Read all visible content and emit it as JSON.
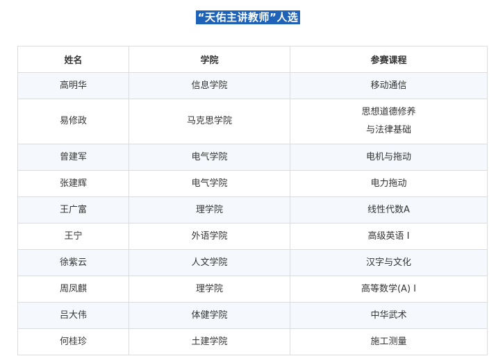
{
  "title": "“天佑主讲教师”人选",
  "headers": [
    "姓名",
    "学院",
    "参赛课程"
  ],
  "rows": [
    {
      "name": "高明华",
      "college": "信息学院",
      "course": [
        "移动通信"
      ]
    },
    {
      "name": "易修政",
      "college": "马克思学院",
      "course": [
        "思想道德修养",
        "与法律基础"
      ]
    },
    {
      "name": "曾建军",
      "college": "电气学院",
      "course": [
        "电机与拖动"
      ]
    },
    {
      "name": "张建辉",
      "college": "电气学院",
      "course": [
        "电力拖动"
      ]
    },
    {
      "name": "王广富",
      "college": "理学院",
      "course": [
        "线性代数A"
      ]
    },
    {
      "name": "王宁",
      "college": "外语学院",
      "course": [
        "高级英语 I"
      ]
    },
    {
      "name": "徐紫云",
      "college": "人文学院",
      "course": [
        "汉字与文化"
      ]
    },
    {
      "name": "周凤麒",
      "college": "理学院",
      "course": [
        "高等数学(A) I"
      ]
    },
    {
      "name": "吕大伟",
      "college": "体健学院",
      "course": [
        "中华武术"
      ]
    },
    {
      "name": "何桂珍",
      "college": "土建学院",
      "course": [
        "施工测量"
      ]
    }
  ]
}
